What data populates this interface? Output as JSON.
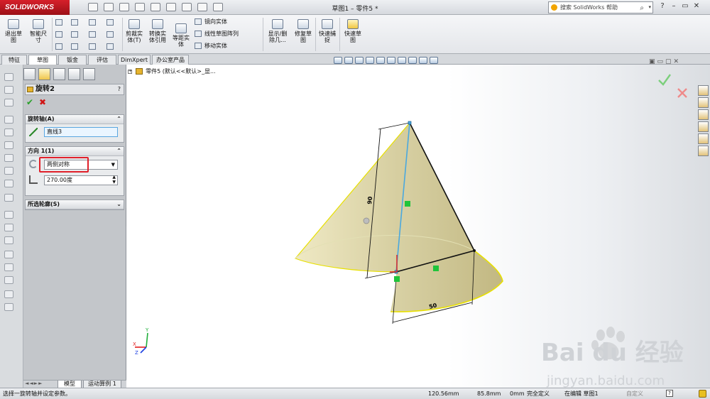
{
  "app": {
    "brand": "SOLIDWORKS",
    "window_title": "草图1 – 零件5 *"
  },
  "search": {
    "placeholder": "搜索 SolidWorks 帮助"
  },
  "window_buttons": {
    "help": "?",
    "minimize": "–",
    "restore": "▭",
    "close": "✕"
  },
  "ribbon": {
    "exit_sketch": "退出草\n图",
    "smart_dimension": "智能尺\n寸",
    "trim_entities": "剪裁实\n体(T)",
    "convert_entities": "转换实\n体引用",
    "offset_entities": "等距实\n体",
    "mirror_entities": "镜向实体",
    "linear_pattern": "线性草图阵列",
    "move_entities": "移动实体",
    "show_delete_relations": "显示/删\n除几...",
    "repair_sketch": "修复草\n图",
    "quick_snaps": "快速捕\n捉",
    "rapid_sketch": "快速草\n图"
  },
  "command_tabs": [
    "特征",
    "草图",
    "钣金",
    "评估",
    "DimXpert",
    "办公室产品"
  ],
  "active_tab": "草图",
  "feature_tree": {
    "root": "零件5  (默认<<默认>_显..."
  },
  "property_manager": {
    "title": "旋转2",
    "help": "?",
    "ok": "✔",
    "cancel": "✖",
    "axis_section": {
      "label": "旋转轴(A)",
      "value": "直线3"
    },
    "direction_section": {
      "label": "方向 1(1)",
      "type_value": "两侧对称",
      "angle_value": "270.00度"
    },
    "contours_section": {
      "label": "所选轮廓(S)"
    }
  },
  "bottom_tabs": [
    "模型",
    "运动算例 1"
  ],
  "dimensions": {
    "vertical": "90",
    "horizontal": "50"
  },
  "statusbar": {
    "message": "选择一旋转轴并设定参数。",
    "x": "120.56mm",
    "y": "85.8mm",
    "z": "0mm",
    "definition": "完全定义",
    "editing": "在编辑 草图1",
    "custom": "自定义"
  },
  "watermark": {
    "brand": "Bai du 经验",
    "url": "jingyan.baidu.com"
  },
  "colors": {
    "brand_red": "#c81a22",
    "cone_fill": "#d8d2a8",
    "highlight_yellow": "#e8e000",
    "axis_blue": "#4aa8e0",
    "selection_red": "#e21b1b",
    "relation_green": "#1fc43a"
  }
}
